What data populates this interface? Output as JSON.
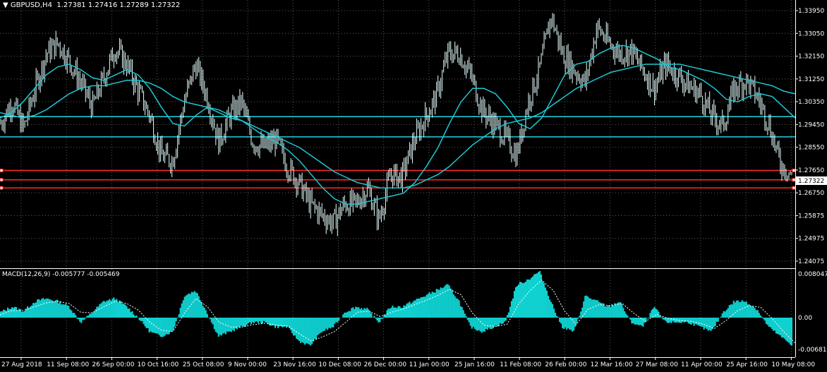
{
  "header": {
    "symbol": "GBPUSD,H4",
    "ohlc": "1.27381 1.27416 1.27289 1.27322",
    "bar_color": "#ffffff",
    "background": "#000000"
  },
  "price_badge": "1.27322",
  "macd_title": "MACD(12,26,9) -0.005777 -0.005469",
  "colors": {
    "candles": "#e6ffff",
    "ma": "#1ec8d2",
    "level_cyan": "#22d3dd",
    "level_red": "#ff2a2a",
    "macd_fill": "#10d0d0",
    "signal": "#ffffff",
    "grid": "#5a5a5a"
  },
  "chart_data": [
    {
      "type": "line",
      "title": "GBPUSD,H4",
      "ylim": [
        1.24075,
        1.33395
      ],
      "y_ticks": [
        "1.33950",
        "1.33050",
        "1.32150",
        "1.31250",
        "1.30350",
        "1.29450",
        "1.28550",
        "1.27650",
        "1.26750",
        "1.25875",
        "1.24975",
        "1.24075"
      ],
      "x_ticks": [
        "27 Aug 2018",
        "11 Sep 08:00",
        "26 Sep 00:00",
        "10 Oct 16:00",
        "25 Oct 08:00",
        "9 Nov 00:00",
        "23 Nov 16:00",
        "10 Dec 08:00",
        "26 Dec 00:00",
        "11 Jan 00:00",
        "25 Jan 16:00",
        "11 Feb 08:00",
        "26 Feb 00:00",
        "12 Mar 16:00",
        "27 Mar 08:00",
        "11 Apr 00:00",
        "25 Apr 16:00",
        "10 May 08:00"
      ],
      "price_series": [
        1.292,
        1.3,
        1.29,
        1.305,
        1.318,
        1.322,
        1.315,
        1.307,
        1.298,
        1.309,
        1.32,
        1.314,
        1.304,
        1.295,
        1.28,
        1.278,
        1.3,
        1.314,
        1.302,
        1.285,
        1.295,
        1.3,
        1.285,
        1.283,
        1.286,
        1.276,
        1.27,
        1.262,
        1.258,
        1.255,
        1.262,
        1.262,
        1.268,
        1.256,
        1.273,
        1.272,
        1.285,
        1.294,
        1.302,
        1.318,
        1.318,
        1.31,
        1.297,
        1.292,
        1.287,
        1.28,
        1.3,
        1.312,
        1.332,
        1.318,
        1.312,
        1.307,
        1.328,
        1.322,
        1.318,
        1.319,
        1.312,
        1.305,
        1.314,
        1.31,
        1.306,
        1.303,
        1.295,
        1.291,
        1.305,
        1.308,
        1.302,
        1.292,
        1.277,
        1.2732
      ],
      "moving_averages": [
        {
          "values": [
            1.294,
            1.296,
            1.3,
            1.305,
            1.31,
            1.313,
            1.314,
            1.312,
            1.309,
            1.308,
            1.31,
            1.312,
            1.31,
            1.305,
            1.298,
            1.292,
            1.291,
            1.295,
            1.298,
            1.296,
            1.294,
            1.293,
            1.29,
            1.287,
            1.285,
            1.282,
            1.278,
            1.273,
            1.268,
            1.264,
            1.262,
            1.262,
            1.263,
            1.264,
            1.265,
            1.266,
            1.27,
            1.276,
            1.283,
            1.292,
            1.3,
            1.305,
            1.305,
            1.303,
            1.298,
            1.292,
            1.29,
            1.294,
            1.302,
            1.31,
            1.314,
            1.315,
            1.318,
            1.32,
            1.321,
            1.32,
            1.318,
            1.316,
            1.313,
            1.312,
            1.31,
            1.308,
            1.305,
            1.301,
            1.3,
            1.302,
            1.303,
            1.302,
            1.298,
            1.294
          ]
        },
        {
          "values": [
            1.296,
            1.295,
            1.294,
            1.295,
            1.297,
            1.3,
            1.303,
            1.305,
            1.306,
            1.306,
            1.307,
            1.308,
            1.308,
            1.307,
            1.305,
            1.302,
            1.3,
            1.299,
            1.298,
            1.297,
            1.295,
            1.293,
            1.291,
            1.289,
            1.287,
            1.285,
            1.283,
            1.28,
            1.277,
            1.274,
            1.272,
            1.27,
            1.269,
            1.268,
            1.268,
            1.268,
            1.269,
            1.271,
            1.273,
            1.276,
            1.28,
            1.284,
            1.287,
            1.29,
            1.292,
            1.293,
            1.294,
            1.296,
            1.299,
            1.302,
            1.305,
            1.307,
            1.309,
            1.311,
            1.312,
            1.313,
            1.314,
            1.314,
            1.314,
            1.314,
            1.313,
            1.312,
            1.311,
            1.31,
            1.309,
            1.308,
            1.307,
            1.306,
            1.304,
            1.303
          ]
        }
      ],
      "levels_cyan": [
        1.29452,
        1.287
      ],
      "levels_red": [
        1.2745,
        1.271,
        1.268
      ]
    },
    {
      "type": "area",
      "title": "MACD(12,26,9) -0.005777 -0.005469",
      "ylim": [
        -0.006819,
        0.008047
      ],
      "y_ticks": [
        "0.008047",
        "0.00",
        "-0.006819"
      ],
      "macd": [
        0.001,
        0.002,
        0.0012,
        0.003,
        0.0035,
        0.003,
        0.002,
        -0.001,
        0.001,
        0.003,
        0.0035,
        0.002,
        0.0,
        -0.003,
        -0.004,
        -0.003,
        0.004,
        0.005,
        0.001,
        -0.004,
        -0.003,
        -0.002,
        -0.001,
        -0.001,
        -0.002,
        -0.002,
        -0.005,
        -0.006,
        -0.003,
        -0.002,
        0.001,
        0.002,
        0.0015,
        -0.001,
        0.002,
        0.002,
        0.003,
        0.004,
        0.005,
        0.006,
        0.003,
        -0.002,
        -0.003,
        -0.002,
        -0.001,
        0.006,
        0.007,
        0.0085,
        0.003,
        -0.002,
        -0.003,
        0.004,
        0.003,
        0.002,
        0.003,
        -0.001,
        -0.002,
        0.002,
        -0.001,
        -0.001,
        -0.001,
        -0.002,
        -0.003,
        0.001,
        0.003,
        0.003,
        0.0015,
        -0.002,
        -0.004,
        -0.0058
      ],
      "signal": [
        0.0005,
        0.0013,
        0.0013,
        0.002,
        0.0027,
        0.003,
        0.0026,
        0.001,
        0.0009,
        0.002,
        0.003,
        0.0026,
        0.0014,
        -0.001,
        -0.0027,
        -0.003,
        0.0008,
        0.0035,
        0.002,
        -0.001,
        -0.002,
        -0.002,
        -0.0015,
        -0.0012,
        -0.0016,
        -0.0018,
        -0.0035,
        -0.005,
        -0.0041,
        -0.003,
        -0.001,
        0.001,
        0.0012,
        0.0002,
        0.001,
        0.0016,
        0.0024,
        0.0032,
        0.0041,
        0.0052,
        0.0042,
        0.0008,
        -0.0016,
        -0.0019,
        -0.0014,
        0.0025,
        0.005,
        0.0069,
        0.005,
        0.0012,
        -0.0015,
        0.0015,
        0.0024,
        0.0022,
        0.0026,
        0.0008,
        -0.0008,
        0.0006,
        -0.0002,
        -0.0006,
        -0.0008,
        -0.0014,
        -0.0023,
        -0.0006,
        0.0013,
        0.0022,
        0.0019,
        -0.0002,
        -0.003,
        -0.0055
      ]
    }
  ]
}
